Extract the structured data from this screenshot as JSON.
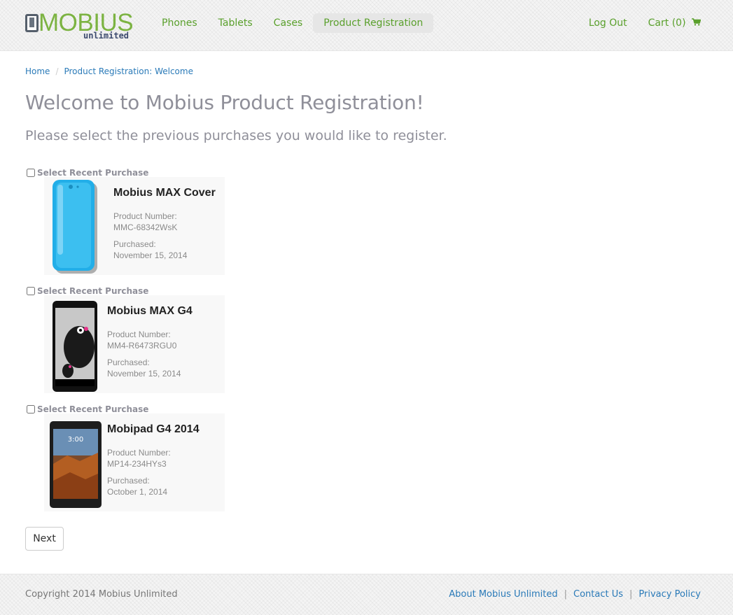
{
  "brand": {
    "name": "MOBIUS",
    "tagline": "unlimited",
    "color": "#7cb342"
  },
  "nav": {
    "items": [
      {
        "label": "Phones"
      },
      {
        "label": "Tablets"
      },
      {
        "label": "Cases"
      },
      {
        "label": "Product Registration",
        "active": true
      }
    ],
    "logout": "Log Out",
    "cart": "Cart (0)"
  },
  "breadcrumb": {
    "home": "Home",
    "separator": "/",
    "current": "Product Registration: Welcome"
  },
  "page": {
    "title": "Welcome to Mobius Product Registration!",
    "subtitle": "Please select the previous purchases you would like to register."
  },
  "purchases": [
    {
      "select_label": "Select Recent Purchase",
      "name": "Mobius MAX Cover",
      "number_label": "Product Number:",
      "number": "MMC-68342WsK",
      "purchased_label": "Purchased:",
      "date": "November 15, 2014",
      "image": "blue-phone-case-icon"
    },
    {
      "select_label": "Select Recent Purchase",
      "name": "Mobius MAX G4",
      "number_label": "Product Number:",
      "number": "MM4-R6473RGU0",
      "purchased_label": "Purchased:",
      "date": "November 15, 2014",
      "image": "smartphone-icon"
    },
    {
      "select_label": "Select Recent Purchase",
      "name": "Mobipad G4 2014",
      "number_label": "Product Number:",
      "number": "MP14-234HYs3",
      "purchased_label": "Purchased:",
      "date": "October 1, 2014",
      "image": "tablet-icon"
    }
  ],
  "next_button": "Next",
  "footer": {
    "copyright": "Copyright 2014 Mobius Unlimited",
    "links": [
      "About Mobius Unlimited",
      "Contact Us",
      "Privacy Policy"
    ],
    "separator": "|"
  }
}
